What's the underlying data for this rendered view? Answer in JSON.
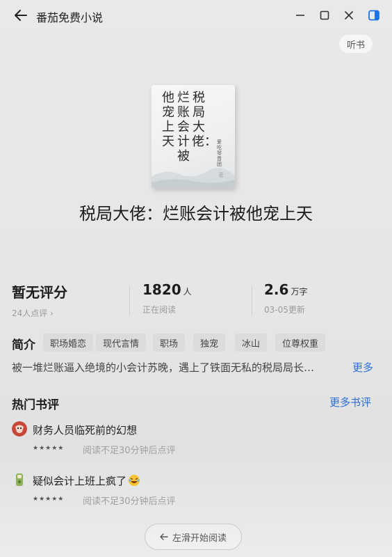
{
  "window": {
    "app_title": "番茄免费小说"
  },
  "header": {
    "listen_label": "听书"
  },
  "cover": {
    "col1": "他宠上天",
    "col2": "烂账会计被",
    "col3": "税局大佬：",
    "author": "爱吃琴音团",
    "author_suffix": "著"
  },
  "book": {
    "title": "税局大佬：烂账会计被他宠上天"
  },
  "stats": {
    "rating_value": "暂无评分",
    "rating_sub": "24人点评 ›",
    "readers_value": "1820",
    "readers_unit": "人",
    "readers_sub": "正在阅读",
    "words_value": "2.6",
    "words_unit": "万字",
    "words_sub": "03-05更新"
  },
  "intro": {
    "label": "简介",
    "tags": [
      "职场婚恋",
      "现代言情",
      "职场",
      "独宠",
      "冰山",
      "位尊权重"
    ],
    "text": "被一堆烂账逼入绝境的小会计苏晚，遇上了铁面无私的税局局长…",
    "more_label": "更多"
  },
  "reviews": {
    "title": "热门书评",
    "more_label": "更多书评",
    "items": [
      {
        "text": "财务人员临死前的幻想",
        "stars": "★★★★★",
        "note": "阅读不足30分钟后点评"
      },
      {
        "text": "疑似会计上班上疯了",
        "stars": "★★★★★",
        "note": "阅读不足30分钟后点评"
      }
    ]
  },
  "footer": {
    "swipe_label": "左滑开始阅读"
  },
  "colors": {
    "accent_link": "#2b6fd6",
    "side_icon": "#1a73e8"
  }
}
